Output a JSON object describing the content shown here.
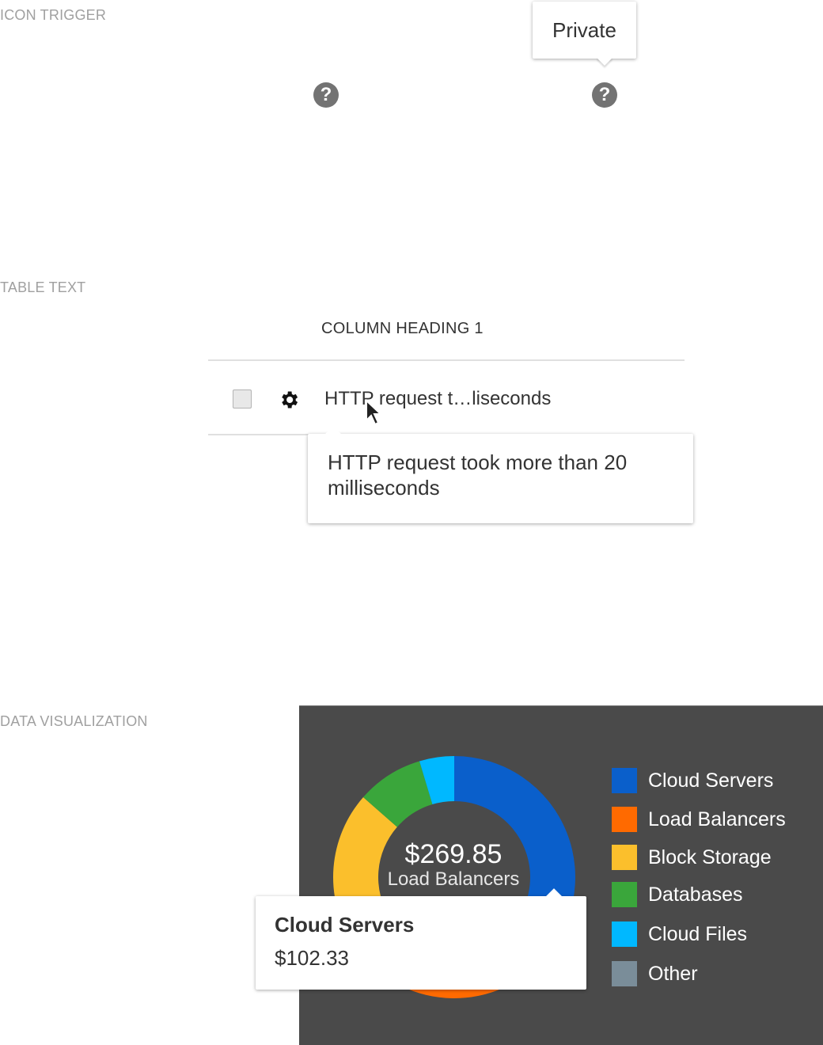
{
  "sections": {
    "icon_trigger": "ICON TRIGGER",
    "table_text": "TABLE TEXT",
    "data_viz": "DATA VISUALIZATION"
  },
  "icon_trigger": {
    "icon": "help-circle-icon",
    "tooltip": "Private"
  },
  "table": {
    "column_heading": "COLUMN HEADING 1",
    "row_icon": "gear-icon",
    "cell_truncated": "HTTP request t…liseconds",
    "tooltip": "HTTP request took more than 20 milliseconds"
  },
  "chart_data": {
    "type": "pie",
    "center_value": "$269.85",
    "center_label": "Load Balancers",
    "categories": [
      "Cloud Servers",
      "Load Balancers",
      "Block Storage",
      "Databases",
      "Cloud Files",
      "Other"
    ],
    "values": [
      102.33,
      76.0,
      55.0,
      24.0,
      12.52,
      0
    ],
    "colors": [
      "#0a5fcb",
      "#ff6a00",
      "#fbbf2c",
      "#3aa63b",
      "#00b8ff",
      "#7a8d99"
    ],
    "tooltip": {
      "title": "Cloud Servers",
      "value": "$102.33"
    }
  }
}
